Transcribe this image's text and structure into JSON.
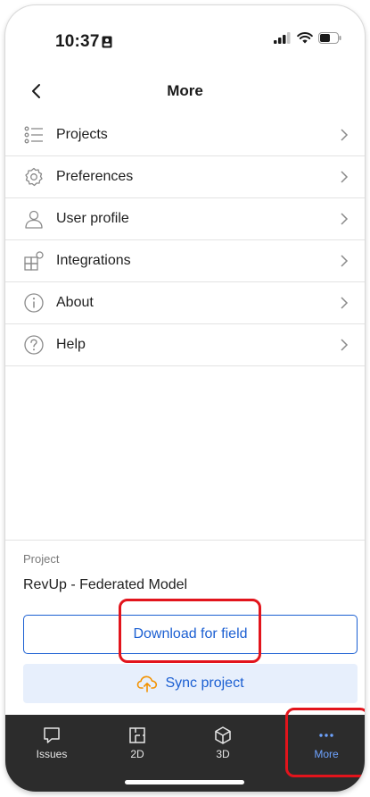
{
  "status_bar": {
    "time": "10:37"
  },
  "header": {
    "title": "More",
    "back_icon": "chevron-left-icon"
  },
  "menu": [
    {
      "label": "Projects",
      "icon": "list-icon"
    },
    {
      "label": "Preferences",
      "icon": "gear-icon"
    },
    {
      "label": "User profile",
      "icon": "user-icon"
    },
    {
      "label": "Integrations",
      "icon": "integrations-icon"
    },
    {
      "label": "About",
      "icon": "info-icon"
    },
    {
      "label": "Help",
      "icon": "help-icon"
    }
  ],
  "project": {
    "label": "Project",
    "name": "RevUp - Federated Model",
    "download_label": "Download for field",
    "sync_label": "Sync project"
  },
  "tabs": [
    {
      "label": "Issues",
      "icon": "comment-icon"
    },
    {
      "label": "2D",
      "icon": "floorplan-icon"
    },
    {
      "label": "3D",
      "icon": "cube-icon"
    },
    {
      "label": "More",
      "icon": "more-dots-icon",
      "active": true
    }
  ],
  "colors": {
    "accent": "#1b5fd2",
    "sync_bg": "#e7effc",
    "tabbar_bg": "#2c2c2c",
    "active_tab": "#6ea3ff",
    "highlight": "#e2141c"
  }
}
